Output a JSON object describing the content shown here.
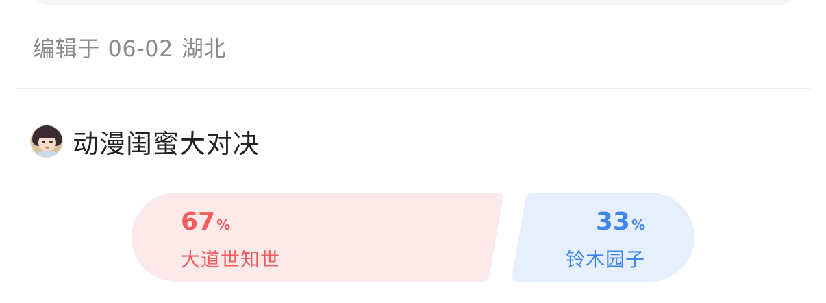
{
  "post_meta": {
    "edited_label": "编辑于",
    "date": "06-02",
    "location": "湖北"
  },
  "topic": {
    "title": "动漫闺蜜大对决",
    "avatar_icon": "anime-girl-avatar"
  },
  "vote": {
    "left": {
      "percent": "67",
      "percent_sign": "%",
      "label": "大道世知世",
      "color": "#f25c5c",
      "bg": "#fce9e9"
    },
    "right": {
      "percent": "33",
      "percent_sign": "%",
      "label": "铃木园子",
      "color": "#3f86f0",
      "bg": "#e6f0fd"
    }
  }
}
